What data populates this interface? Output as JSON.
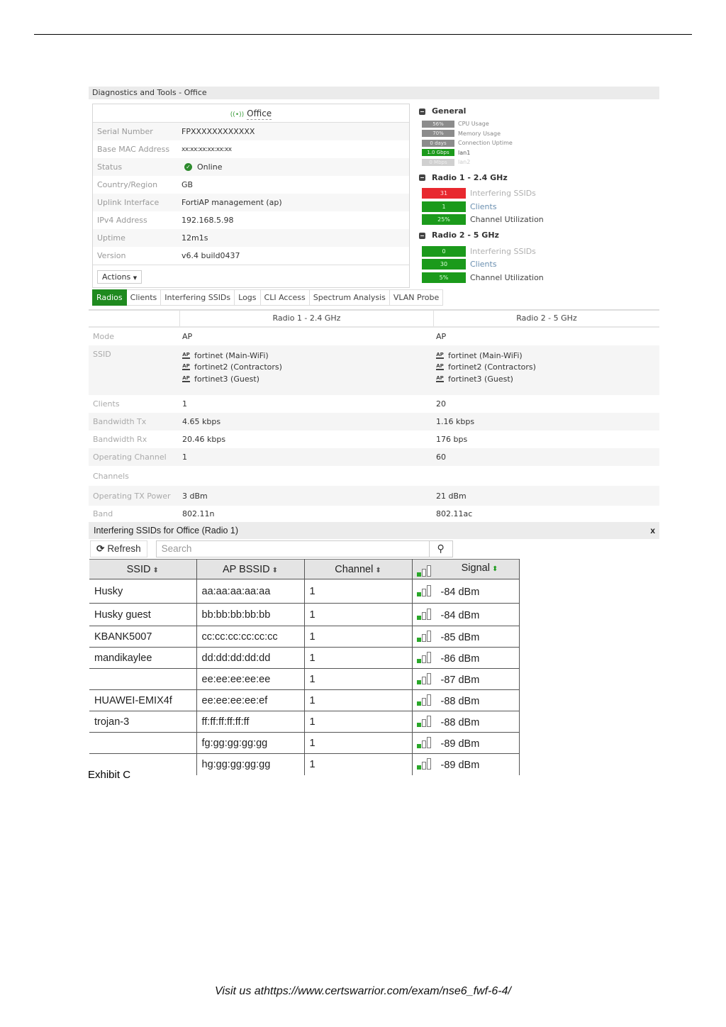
{
  "window_title": "Diagnostics and Tools - Office",
  "ap": {
    "name": "Office",
    "rows": [
      {
        "label": "Serial Number",
        "value": "FPXXXXXXXXXXXX"
      },
      {
        "label": "Base MAC Address",
        "value": "xx:xx:xx:xx:xx:xx"
      },
      {
        "label": "Status",
        "value": "Online",
        "icon": "check-circle-icon"
      },
      {
        "label": "Country/Region",
        "value": "GB"
      },
      {
        "label": "Uplink Interface",
        "value": "FortiAP management (ap)"
      },
      {
        "label": "IPv4 Address",
        "value": "192.168.5.98"
      },
      {
        "label": "Uptime",
        "value": "12m1s"
      },
      {
        "label": "Version",
        "value": "v6.4 build0437"
      }
    ],
    "actions_label": "Actions"
  },
  "general": {
    "title": "General",
    "items": [
      {
        "value": "56%",
        "label": "CPU Usage"
      },
      {
        "value": "70%",
        "label": "Memory Usage"
      },
      {
        "value": "0 days",
        "label": "Connection Uptime"
      },
      {
        "value": "1.0 Gbps",
        "label": "lan1"
      },
      {
        "value": "0 Mbps",
        "label": "lan2"
      }
    ]
  },
  "radio1_summary": {
    "title": "Radio 1 - 2.4 GHz",
    "items": [
      {
        "value": "31",
        "label": "Interfering SSIDs",
        "color": "#e8282f"
      },
      {
        "value": "1",
        "label": "Clients",
        "color": "#1b9a1b"
      },
      {
        "value": "25%",
        "label": "Channel Utilization",
        "color": "#1b9a1b"
      }
    ]
  },
  "radio2_summary": {
    "title": "Radio 2 - 5 GHz",
    "items": [
      {
        "value": "0",
        "label": "Interfering SSIDs",
        "color": "#1b9a1b"
      },
      {
        "value": "30",
        "label": "Clients",
        "color": "#1b9a1b"
      },
      {
        "value": "5%",
        "label": "Channel Utilization",
        "color": "#1b9a1b"
      }
    ]
  },
  "tabs": [
    "Radios",
    "Clients",
    "Interfering SSIDs",
    "Logs",
    "CLI Access",
    "Spectrum Analysis",
    "VLAN Probe"
  ],
  "active_tab": "Radios",
  "radios": {
    "col1": "Radio 1 - 2.4 GHz",
    "col2": "Radio 2 - 5 GHz",
    "mode": {
      "label": "Mode",
      "r1": "AP",
      "r2": "AP"
    },
    "ssid": {
      "label": "SSID",
      "list": [
        "fortinet (Main-WiFi)",
        "fortinet2 (Contractors)",
        "fortinet3 (Guest)"
      ],
      "badge": "AP"
    },
    "rows": [
      {
        "label": "Clients",
        "r1": "1",
        "r2": "20"
      },
      {
        "label": "Bandwidth Tx",
        "r1": "4.65 kbps",
        "r2": "1.16 kbps"
      },
      {
        "label": "Bandwidth Rx",
        "r1": "20.46 kbps",
        "r2": "176 bps"
      },
      {
        "label": "Operating Channel",
        "r1": "1",
        "r2": "60"
      },
      {
        "label": "Channels",
        "r1": "",
        "r2": ""
      },
      {
        "label": "Operating TX Power",
        "r1": "3 dBm",
        "r2": "21 dBm"
      },
      {
        "label": "Band",
        "r1": "802.11n",
        "r2": "802.11ac"
      }
    ]
  },
  "interfering": {
    "title": "Interfering SSIDs for Office (Radio 1)",
    "close_label": "x",
    "refresh_label": "Refresh",
    "search_placeholder": "Search",
    "columns": [
      "SSID",
      "AP BSSID",
      "Channel",
      "Signal"
    ],
    "rows": [
      {
        "ssid": "Husky",
        "bssid": "aa:aa:aa:aa:aa",
        "channel": "1",
        "signal": "-84 dBm"
      },
      {
        "ssid": "Husky guest",
        "bssid": "bb:bb:bb:bb:bb",
        "channel": "1",
        "signal": "-84 dBm"
      },
      {
        "ssid": "KBANK5007",
        "bssid": "cc:cc:cc:cc:cc:cc",
        "channel": "1",
        "signal": "-85 dBm"
      },
      {
        "ssid": "mandikaylee",
        "bssid": "dd:dd:dd:dd:dd",
        "channel": "1",
        "signal": "-86 dBm"
      },
      {
        "ssid": "",
        "bssid": "ee:ee:ee:ee:ee",
        "channel": "1",
        "signal": "-87 dBm"
      },
      {
        "ssid": "HUAWEI-EMIX4f",
        "bssid": "ee:ee:ee:ee:ef",
        "channel": "1",
        "signal": "-88 dBm"
      },
      {
        "ssid": "trojan-3",
        "bssid": "ff:ff:ff:ff:ff:ff",
        "channel": "1",
        "signal": "-88 dBm"
      },
      {
        "ssid": "",
        "bssid": "fg:gg:gg:gg:gg",
        "channel": "1",
        "signal": "-89 dBm"
      },
      {
        "ssid": "",
        "bssid": "hg:gg:gg:gg:gg",
        "channel": "1",
        "signal": "-89 dBm"
      }
    ]
  },
  "caption": "Exhibit C",
  "footer": "Visit us athttps://www.certswarrior.com/exam/nse6_fwf-6-4/"
}
